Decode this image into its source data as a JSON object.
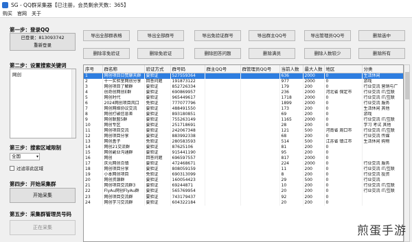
{
  "window": {
    "title": "SG - QQ群采集器【已注册，会员剩余天数：365】"
  },
  "menu": [
    "购买",
    "官网",
    "关于"
  ],
  "left": {
    "step1": "第一步：登录QQ",
    "login_line1": "已登录：813093742",
    "login_line2": "重新登录",
    "step2": "第二步：设置搜索关键词",
    "keyword": "网创",
    "step3": "第三步：搜索区域限制",
    "region": "全国",
    "filter_label": "过滤非此区域",
    "step4": "第四步：开始采集群",
    "start_btn": "开始采集",
    "step5": "第五步：采集群管理员号码",
    "running_btn": "正在采集"
  },
  "toolbar": {
    "row1": [
      "导出全部群表格",
      "导出全部群号",
      "导出免验证群号",
      "导出群主QQ号",
      "导出管理员QQ号",
      "删除选中"
    ],
    "row2": [
      "删除非免验证",
      "删除免验证",
      "删除回答问题",
      "删除满员",
      "删除人数较少",
      "删除所有"
    ]
  },
  "table": {
    "columns": [
      "序号",
      "群名称",
      "验证方式",
      "群号码",
      "群主QQ号",
      "群管理员QQ号",
      "当前人数",
      "最大人数",
      "地区",
      "分类"
    ],
    "rows": [
      [
        "1",
        "网创项目日赞聊天群",
        "要验证",
        "527559364",
        "",
        "",
        "636",
        "2000",
        "0",
        "生活休闲"
      ],
      [
        "2",
        "十一实验室网创分享",
        "回答问题",
        "191873122",
        "",
        "",
        "977",
        "2000",
        "0",
        "游戏"
      ],
      [
        "3",
        "网创项目了解群",
        "要验证",
        "852726334",
        "",
        "",
        "179",
        "200",
        "0",
        "行业交流 营销与广"
      ],
      [
        "4",
        "创奇创网创E群",
        "要验证",
        "690869957",
        "",
        "",
        "236",
        "2000",
        "河北省 保定市",
        "行业交流 IT/互联"
      ],
      [
        "5",
        "网创时代",
        "要验证",
        "965449617",
        "",
        "",
        "1718",
        "2000",
        "0",
        "行业交流 IT/互联"
      ],
      [
        "6",
        "2024网创项目风口",
        "免验证",
        "777077796",
        "",
        "",
        "1899",
        "2000",
        "0",
        "行业交流 服务"
      ],
      [
        "7",
        "网创网络协议交流",
        "要验证",
        "488491550",
        "",
        "",
        "173",
        "200",
        "0",
        "生活休闲 其他"
      ],
      [
        "8",
        "网创打破信息差",
        "要验证",
        "893180851",
        "",
        "",
        "69",
        "200",
        "0",
        "游戏"
      ],
      [
        "9",
        "网创联盟5群",
        "要验证",
        "755263149",
        "",
        "",
        "1165",
        "2000",
        "0",
        "行业交流 IT/互联"
      ],
      [
        "10",
        "网创专区",
        "要验证",
        "251718691",
        "",
        "",
        "28",
        "200",
        "0",
        "学习 考试 其他"
      ],
      [
        "11",
        "网创项目交流",
        "要验证",
        "242067348",
        "",
        "",
        "121",
        "500",
        "河南省 周口市",
        "行业交流 IT/互联"
      ],
      [
        "12",
        "网创项目分享",
        "要验证",
        "883992338",
        "",
        "",
        "68",
        "200",
        "0",
        "行业交流 传媒"
      ],
      [
        "13",
        "网创盒子",
        "免验证",
        "280583593",
        "",
        "",
        "514",
        "500",
        "江苏省 镇江市",
        "生活休闲 购物"
      ],
      [
        "14",
        "网创21交流群",
        "要验证",
        "87625106",
        "",
        "",
        "81",
        "200",
        "0",
        ""
      ],
      [
        "15",
        "网创副业沟通群",
        "要验证",
        "915441190",
        "",
        "",
        "95",
        "200",
        "0",
        ""
      ],
      [
        "16",
        "网创",
        "回答问题",
        "696597557",
        "",
        "",
        "817",
        "2000",
        "0",
        ""
      ],
      [
        "17",
        "庆元网创合镇",
        "要验证",
        "472468671",
        "",
        "",
        "224",
        "2000",
        "0",
        "行业交流 服务"
      ],
      [
        "18",
        "网创项目分享",
        "要验证",
        "808059159",
        "",
        "",
        "11",
        "200",
        "0",
        "行业交流 IT/互联"
      ],
      [
        "19",
        "小本网创项目",
        "免验证",
        "690313099",
        "",
        "",
        "8",
        "200",
        "0",
        "行业交流 投资"
      ],
      [
        "20",
        "网创资源群",
        "要验证",
        "160054423",
        "",
        "",
        "29",
        "500",
        "0",
        "行业交流"
      ],
      [
        "21",
        "网创项目交流群3",
        "要验证",
        "69244871",
        "",
        "",
        "10",
        "200",
        "0",
        "行业交流 IT/互联"
      ],
      [
        "22",
        "FlyAu网创FlyAu群",
        "要验证",
        "565769954",
        "",
        "",
        "20",
        "200",
        "0",
        "行业交流 IT/互联"
      ],
      [
        "23",
        "网创项目交流群",
        "要验证",
        "743179437",
        "",
        "",
        "92",
        "200",
        "0",
        ""
      ],
      [
        "24",
        "网创学习交流群",
        "要验证",
        "604322184",
        "",
        "",
        "20",
        "200",
        "0",
        ""
      ]
    ]
  },
  "watermark": "煎蛋手游"
}
